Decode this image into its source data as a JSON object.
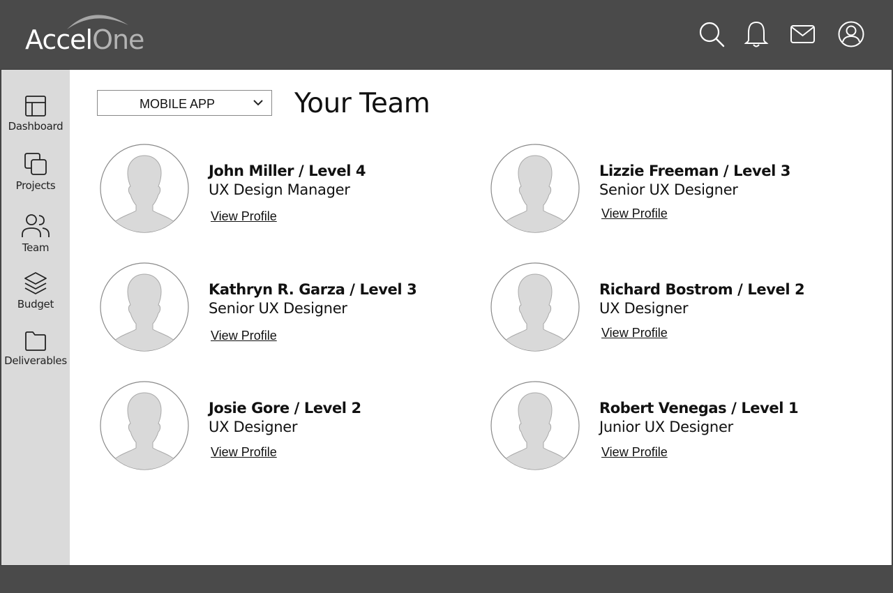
{
  "brand": {
    "logo_part1": "Accel",
    "logo_part2": "One"
  },
  "header": {
    "icons": [
      "search-icon",
      "bell-icon",
      "mail-icon",
      "user-icon"
    ]
  },
  "sidebar": {
    "items": [
      {
        "label": "Dashboard",
        "icon": "dashboard-icon"
      },
      {
        "label": "Projects",
        "icon": "projects-icon"
      },
      {
        "label": "Team",
        "icon": "team-icon"
      },
      {
        "label": "Budget",
        "icon": "budget-icon"
      },
      {
        "label": "Deliverables",
        "icon": "folder-icon"
      }
    ]
  },
  "main": {
    "project_select": {
      "value": "MOBILE APP"
    },
    "title": "Your Team",
    "members": [
      {
        "name": "John Miller / Level 4",
        "role": "UX Design Manager",
        "link": "View Profile"
      },
      {
        "name": "Lizzie Freeman / Level 3",
        "role": "Senior UX Designer",
        "link": "View Profile"
      },
      {
        "name": "Kathryn R. Garza / Level 3",
        "role": "Senior UX Designer",
        "link": "View Profile"
      },
      {
        "name": "Richard Bostrom / Level 2",
        "role": "UX Designer",
        "link": "View Profile"
      },
      {
        "name": "Josie Gore / Level 2",
        "role": "UX Designer",
        "link": "View Profile"
      },
      {
        "name": "Robert Venegas / Level 1",
        "role": "Junior UX Designer",
        "link": "View Profile"
      }
    ]
  },
  "colors": {
    "header_bg": "#4a4a4a",
    "sidebar_bg": "#dadada",
    "content_bg": "#ffffff",
    "avatar_fill": "#d9d9d9"
  }
}
